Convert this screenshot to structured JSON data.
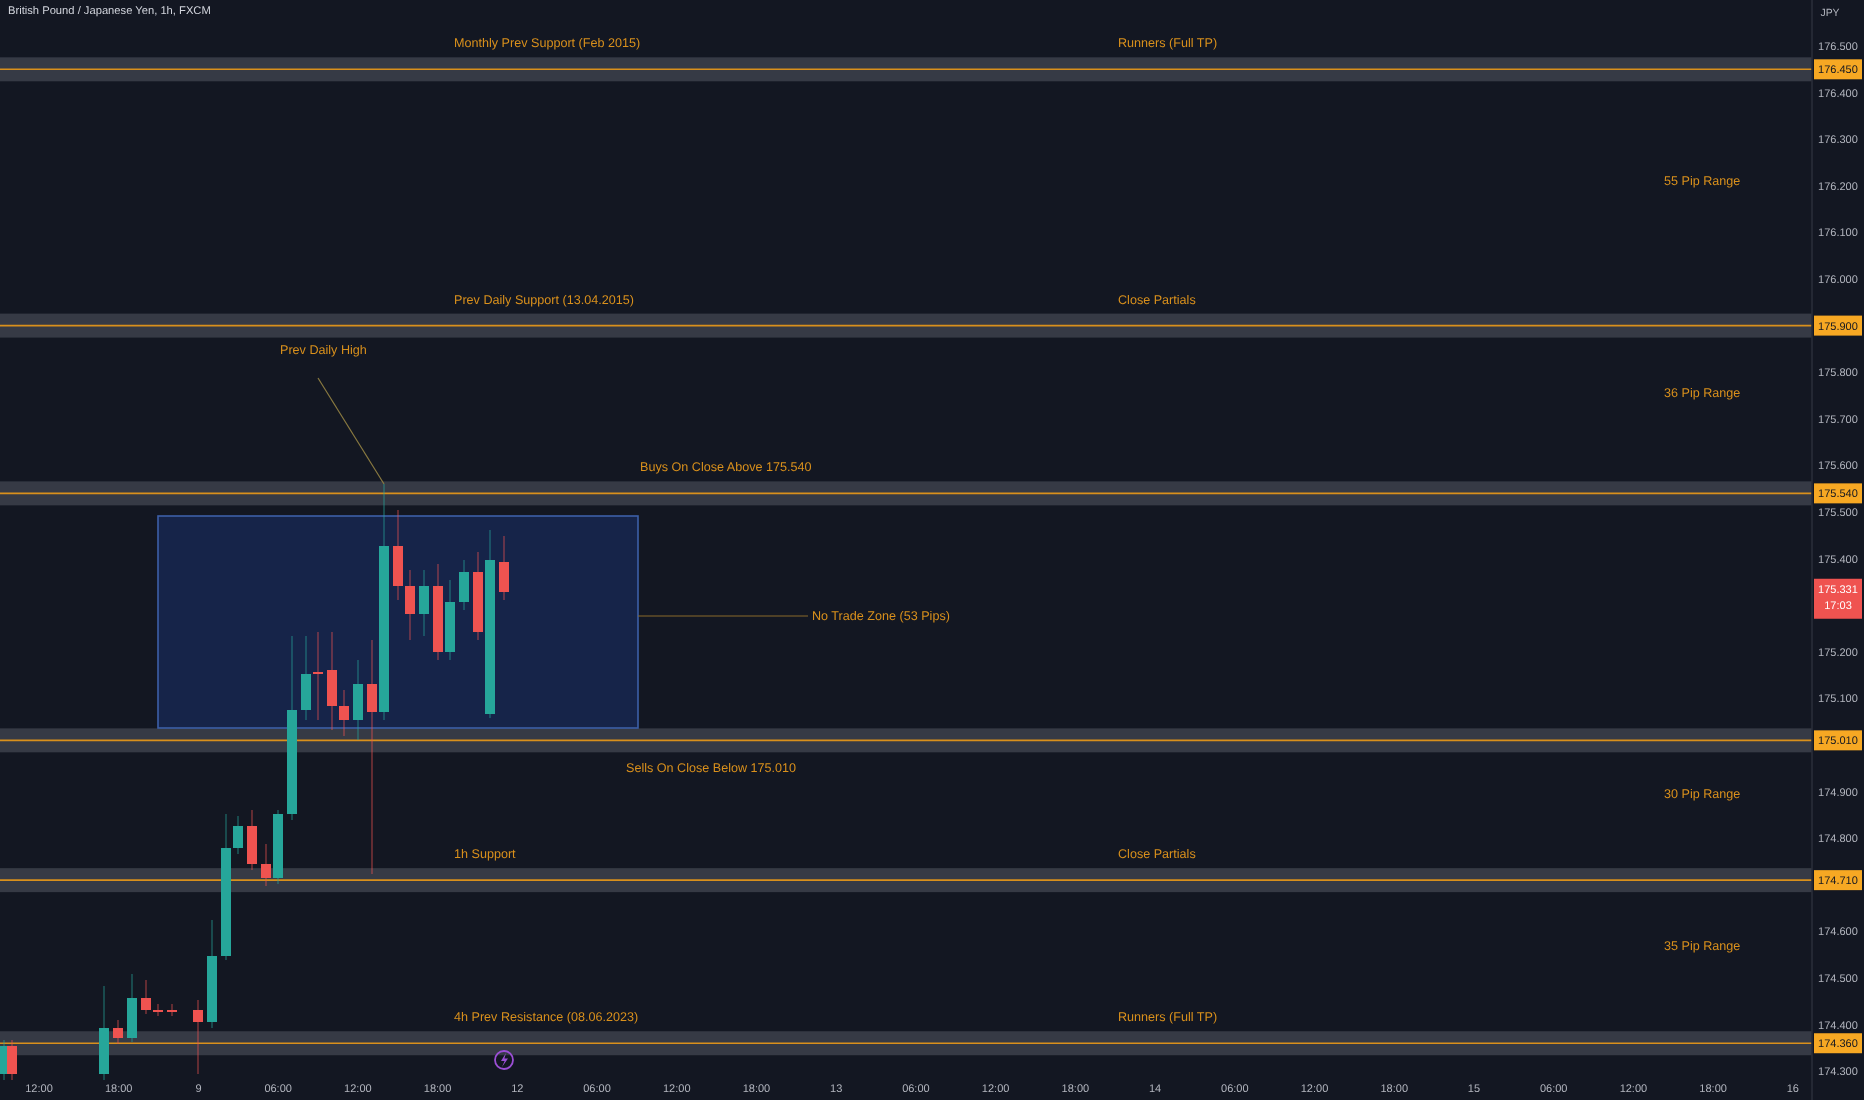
{
  "chart": {
    "title": "British Pound / Japanese Yen, 1h, FXCM",
    "currency": "JPY",
    "price_ticks": [
      "176.500",
      "176.400",
      "176.300",
      "176.200",
      "176.100",
      "176.000",
      "175.800",
      "175.700",
      "175.600",
      "175.500",
      "175.400",
      "175.200",
      "175.100",
      "174.900",
      "174.800",
      "174.600",
      "174.500",
      "174.400",
      "174.300"
    ],
    "time_ticks": [
      "12:00",
      "18:00",
      "9",
      "06:00",
      "12:00",
      "18:00",
      "12",
      "06:00",
      "12:00",
      "18:00",
      "13",
      "06:00",
      "12:00",
      "18:00",
      "14",
      "06:00",
      "12:00",
      "18:00",
      "15",
      "06:00",
      "12:00",
      "18:00",
      "16"
    ],
    "levels": [
      {
        "price": "176.450",
        "labels": [
          {
            "text": "Monthly Prev Support (Feb 2015)",
            "kind": "left"
          },
          {
            "text": "Runners (Full TP)",
            "kind": "right"
          }
        ],
        "range_below": "55 Pip Range"
      },
      {
        "price": "175.900",
        "labels": [
          {
            "text": "Prev Daily Support (13.04.2015)",
            "kind": "left"
          },
          {
            "text": "Close Partials",
            "kind": "right"
          }
        ],
        "range_below": "36 Pip Range"
      },
      {
        "price": "175.540",
        "labels": [
          {
            "text": "Buys On Close Above 175.540",
            "kind": "middle"
          }
        ]
      },
      {
        "price": "175.010",
        "labels": [
          {
            "text": "Sells On Close Below 175.010",
            "kind": "below"
          }
        ],
        "range_below": "30 Pip Range"
      },
      {
        "price": "174.710",
        "labels": [
          {
            "text": "1h Support",
            "kind": "left"
          },
          {
            "text": "Close Partials",
            "kind": "right"
          }
        ],
        "range_below": "35 Pip Range"
      },
      {
        "price": "174.360",
        "labels": [
          {
            "text": "4h Prev Resistance (08.06.2023)",
            "kind": "left"
          },
          {
            "text": "Runners (Full TP)",
            "kind": "right"
          }
        ]
      }
    ],
    "annotations": [
      {
        "kind": "callout",
        "text": "Prev Daily High"
      },
      {
        "kind": "zone",
        "text": "No Trade Zone (53 Pips)"
      }
    ],
    "current_price": {
      "price": "175.331",
      "countdown": "17:03"
    }
  }
}
